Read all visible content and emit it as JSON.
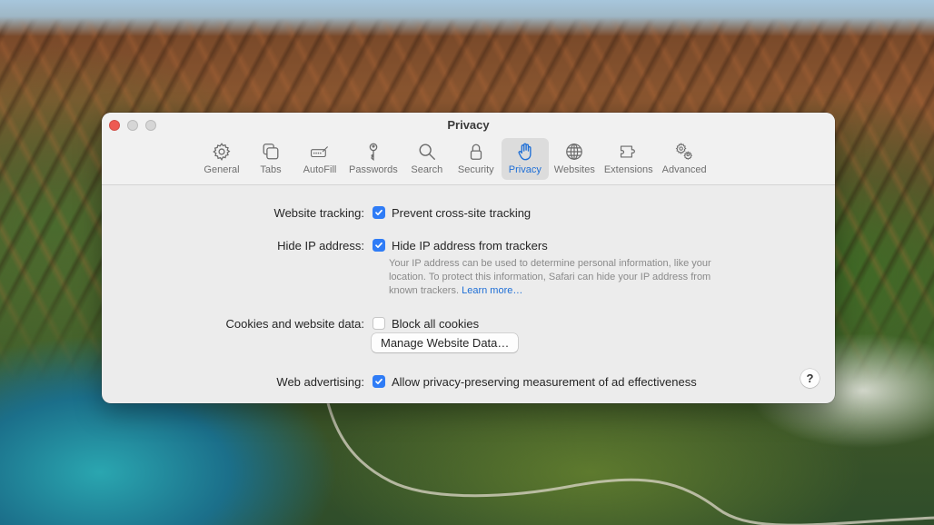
{
  "window": {
    "title": "Privacy"
  },
  "toolbar": {
    "tabs": [
      {
        "label": "General",
        "icon": "gear-icon"
      },
      {
        "label": "Tabs",
        "icon": "tabs-icon"
      },
      {
        "label": "AutoFill",
        "icon": "autofill-icon"
      },
      {
        "label": "Passwords",
        "icon": "key-icon"
      },
      {
        "label": "Search",
        "icon": "search-icon"
      },
      {
        "label": "Security",
        "icon": "lock-icon"
      },
      {
        "label": "Privacy",
        "icon": "hand-icon",
        "active": true
      },
      {
        "label": "Websites",
        "icon": "globe-icon"
      },
      {
        "label": "Extensions",
        "icon": "puzzle-icon"
      },
      {
        "label": "Advanced",
        "icon": "gears-icon"
      }
    ]
  },
  "settings": {
    "website_tracking": {
      "label": "Website tracking:",
      "option": "Prevent cross-site tracking",
      "checked": true
    },
    "hide_ip": {
      "label": "Hide IP address:",
      "option": "Hide IP address from trackers",
      "checked": true,
      "description": "Your IP address can be used to determine personal information, like your location. To protect this information, Safari can hide your IP address from known trackers.",
      "learn_more": "Learn more…"
    },
    "cookies": {
      "label": "Cookies and website data:",
      "option": "Block all cookies",
      "checked": false,
      "manage_button": "Manage Website Data…"
    },
    "advertising": {
      "label": "Web advertising:",
      "option": "Allow privacy-preserving measurement of ad effectiveness",
      "checked": true
    }
  },
  "help_button": "?",
  "colors": {
    "accent": "#2f7cf6",
    "active_tab_text": "#1f6fd6",
    "close_button": "#ee5a52"
  }
}
